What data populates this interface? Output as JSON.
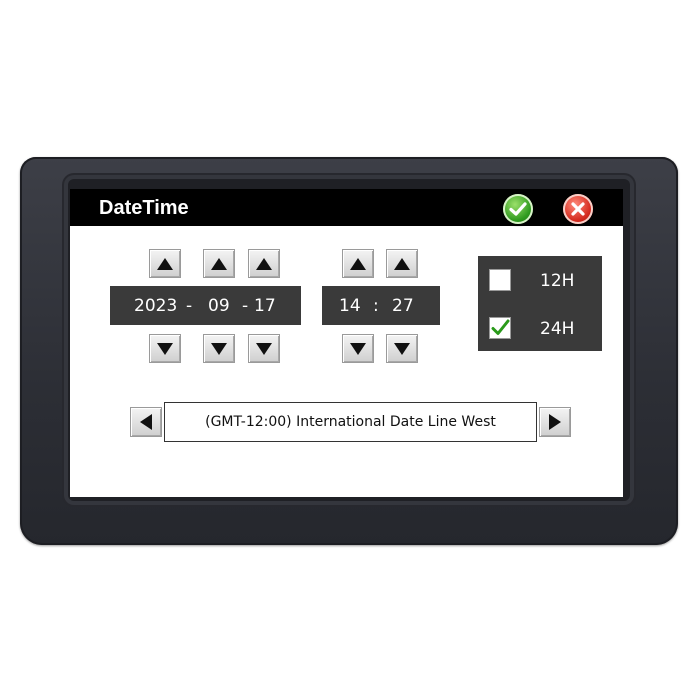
{
  "window": {
    "title": "DateTime"
  },
  "toolbar": {
    "ok_icon": "check-icon",
    "cancel_icon": "close-icon",
    "ok_color": "#2f9a1e",
    "cancel_color": "#d42a1e"
  },
  "date": {
    "year": "2023",
    "month": "09",
    "day": "17",
    "separator": "-"
  },
  "time": {
    "hour": "14",
    "minute": "27",
    "separator": ":"
  },
  "clock_mode": {
    "options": [
      {
        "label": "12H",
        "checked": false
      },
      {
        "label": "24H",
        "checked": true
      }
    ]
  },
  "timezone": {
    "value": "(GMT-12:00) International Date Line West"
  }
}
